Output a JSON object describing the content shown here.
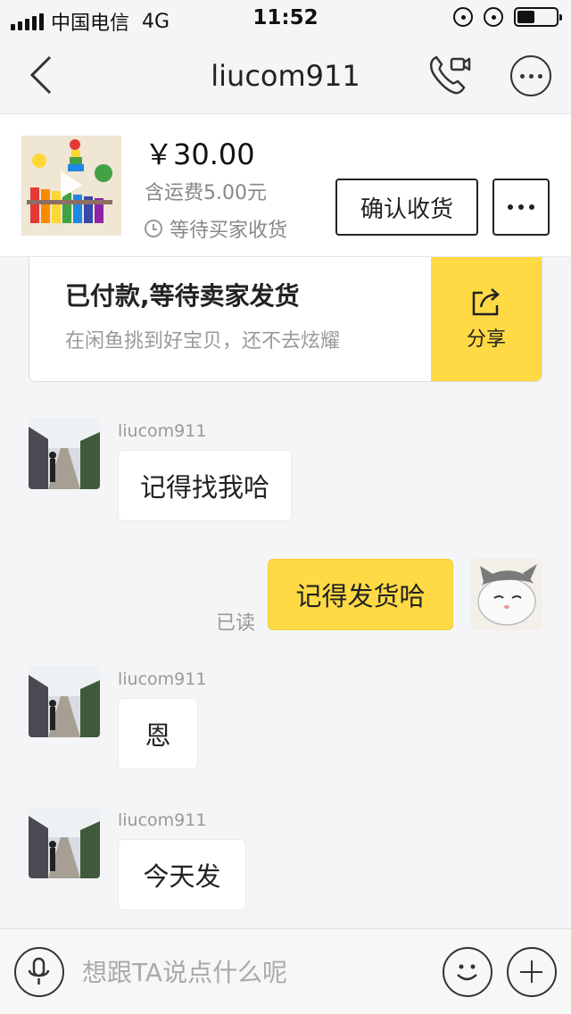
{
  "status_bar": {
    "carrier": "中国电信",
    "network": "4G",
    "time": "11:52",
    "battery_level": 0.45
  },
  "nav": {
    "title": "liucom911"
  },
  "product": {
    "price": "￥30.00",
    "shipping": "含运费5.00元",
    "status": "等待买家收货",
    "confirm_label": "确认收货"
  },
  "notice": {
    "title": "已付款,等待卖家发货",
    "subtitle": "在闲鱼挑到好宝贝，还不去炫耀",
    "share_label": "分享",
    "accent": "#ffda44"
  },
  "messages": [
    {
      "sender": "liucom911",
      "text": "记得找我哈"
    },
    {
      "sender": "me",
      "text": "记得发货哈",
      "read": "已读"
    },
    {
      "sender": "liucom911",
      "text": "恩"
    },
    {
      "sender": "liucom911",
      "text": "今天发"
    }
  ],
  "input": {
    "placeholder": "想跟TA说点什么呢"
  }
}
